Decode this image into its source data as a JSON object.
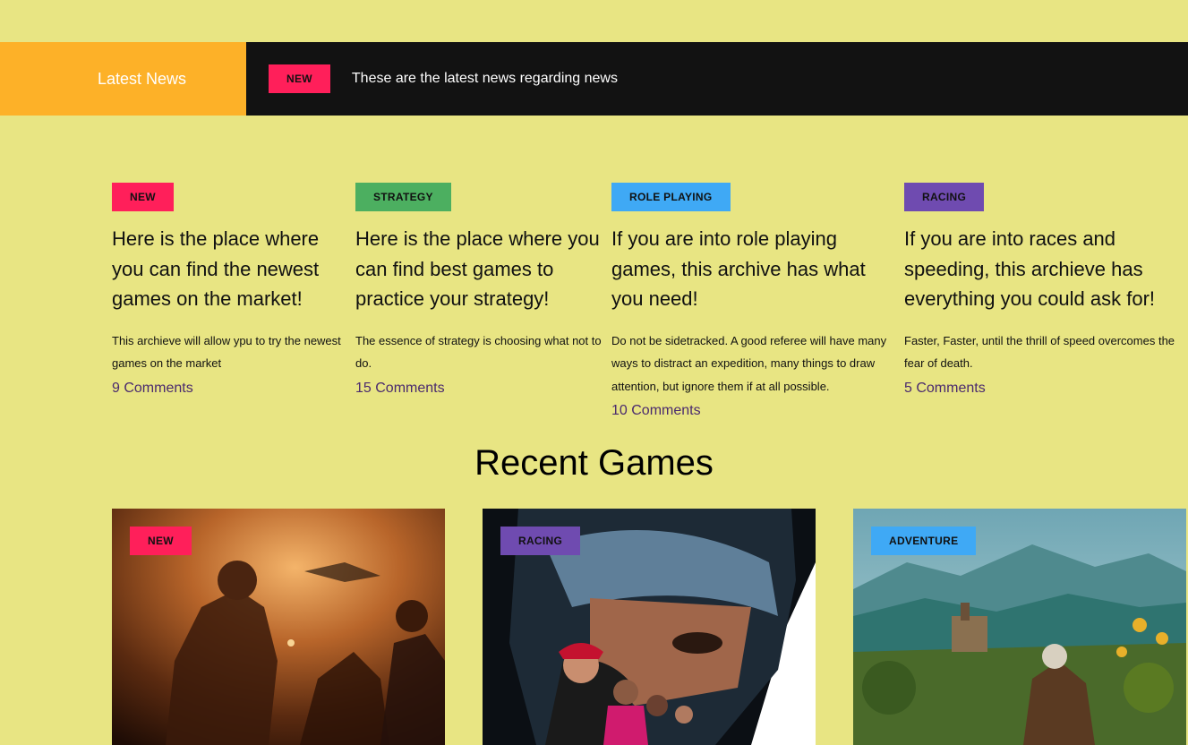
{
  "ticker": {
    "label": "Latest News",
    "badge": "NEW",
    "text": "These are the latest news regarding news",
    "label_color": "#fdb128",
    "badge_color": "#ff1f5a"
  },
  "news": [
    {
      "badge": "NEW",
      "badge_color": "#ff1f5a",
      "title": "Here is the place where you can find the newest games on the market!",
      "description": "This archieve will allow ypu to try the newest games on the market",
      "comments": "9 Comments"
    },
    {
      "badge": "STRATEGY",
      "badge_color": "#4caf60",
      "title": "Here is the place where you can find best games to practice your strategy!",
      "description": "The essence of strategy is choosing what not to do.",
      "comments": "15 Comments"
    },
    {
      "badge": "ROLE PLAYING",
      "badge_color": "#3fa9f5",
      "title": "If you are into role playing games, this archive has what you need!",
      "description": "Do not be sidetracked. A good referee will have many ways to distract an expedition, many things to draw attention, but ignore them if at all possible.",
      "comments": "10 Comments"
    },
    {
      "badge": "RACING",
      "badge_color": "#6f4bb0",
      "title": "If you are into races and speeding, this archieve has everything you could ask for!",
      "description": "Faster, Faster, until the thrill of speed overcomes the fear of death.",
      "comments": "5 Comments"
    }
  ],
  "recent": {
    "title": "Recent Games",
    "games": [
      {
        "badge": "NEW",
        "badge_color": "#ff1f5a",
        "image": "armored-soldier-battle-artwork"
      },
      {
        "badge": "RACING",
        "badge_color": "#6f4bb0",
        "image": "racing-driver-helmet-artwork"
      },
      {
        "badge": "ADVENTURE",
        "badge_color": "#3fa9f5",
        "image": "fantasy-landscape-artwork"
      }
    ]
  }
}
